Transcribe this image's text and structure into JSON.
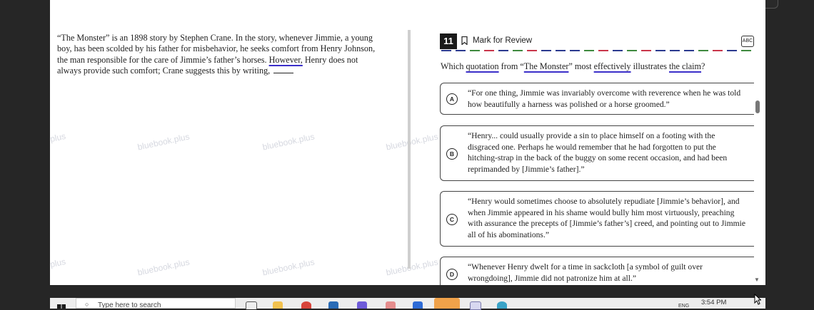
{
  "passage": {
    "text_pre": "“The Monster” is an 1898 story by Stephen Crane. In the story, whenever Jimmie, a young boy, has been scolded by his father for misbehavior, he seeks comfort from Henry Johnson, the man responsible for the care of Jimmie’s father’s horses. ",
    "highlight": "However,",
    "text_post": " Henry does not always provide such comfort; Crane suggests this by writing, "
  },
  "question": {
    "number": "11",
    "mark_label": "Mark for Review",
    "abc_label": "ABC",
    "prompt_parts": [
      {
        "t": "Which ",
        "u": false
      },
      {
        "t": "quotation",
        "u": true
      },
      {
        "t": " from “",
        "u": false
      },
      {
        "t": "The Monster",
        "u": true
      },
      {
        "t": "” most ",
        "u": false
      },
      {
        "t": "effectively",
        "u": true
      },
      {
        "t": " illustrates ",
        "u": false
      },
      {
        "t": "the claim",
        "u": true
      },
      {
        "t": "?",
        "u": false
      }
    ],
    "choices": [
      {
        "letter": "A",
        "text": "“For one thing, Jimmie was invariably overcome with reverence when he was told how beautifully a harness was polished or a horse groomed.”"
      },
      {
        "letter": "B",
        "text": "“Henry... could usually provide a sin to place himself on a footing with the disgraced one. Perhaps he would remember that he had forgotten to put the hitching-strap in the back of the buggy on some recent occasion, and had been reprimanded by [Jimmie’s father].”"
      },
      {
        "letter": "C",
        "text": "“Henry would sometimes choose to absolutely repudiate [Jimmie’s behavior], and when Jimmie appeared in his shame would bully him most virtuously, preaching with assurance the precepts of [Jimmie’s father’s] creed, and pointing out to Jimmie all of his abominations.”"
      },
      {
        "letter": "D",
        "text": "“Whenever Henry dwelt for a time in sackcloth [a symbol of guilt over wrongdoing], Jimmie did not patronize him at all.”"
      }
    ]
  },
  "watermarks": [
    "plus",
    "bluebook.plus",
    "bluebook.plus",
    "bluebook.plus",
    "plus",
    "bluebook.plus",
    "bluebook.plus",
    "bluebook.plus"
  ],
  "taskbar": {
    "search_placeholder": "Type here to search",
    "language": "ENG",
    "time": "3:54 PM"
  },
  "colors": {
    "accent_underline": "#3b2fc9",
    "dash_colors": [
      "#2b3a8f",
      "#2b3a8f",
      "#3f8a3f",
      "#c9364a",
      "#2b3a8f",
      "#3f8a3f",
      "#c9364a",
      "#2b3a8f"
    ]
  }
}
